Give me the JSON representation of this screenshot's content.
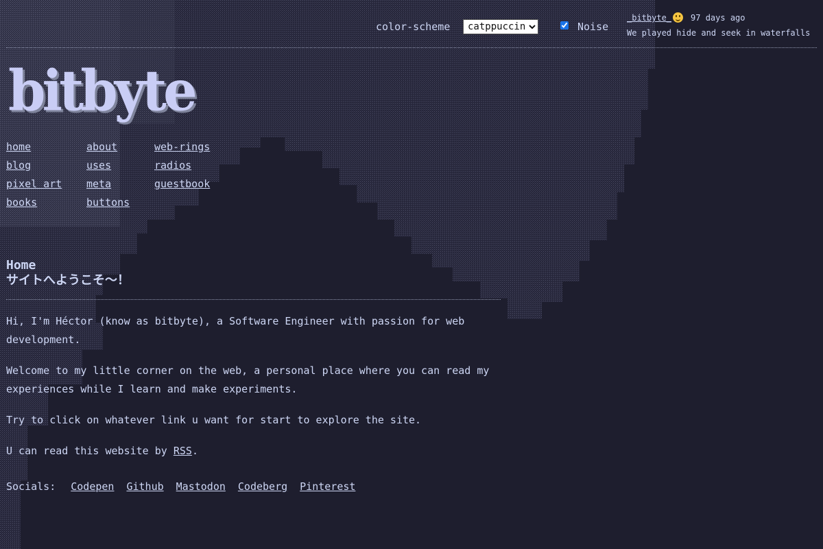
{
  "header": {
    "color_scheme_label": "color-scheme",
    "color_scheme_value": "catppuccin",
    "color_scheme_options": [
      "catppuccin"
    ],
    "noise_label": "Noise",
    "noise_checked": true
  },
  "status": {
    "user": "_bitbyte_",
    "emoji": "smiley-face",
    "age": "97 days ago",
    "message": "We played hide and seek in waterfalls"
  },
  "logo": {
    "text": "bitbyte"
  },
  "nav": {
    "items": [
      {
        "label": "home"
      },
      {
        "label": "about"
      },
      {
        "label": "web-rings"
      },
      {
        "label": "blog"
      },
      {
        "label": "uses"
      },
      {
        "label": "radios"
      },
      {
        "label": "pixel art"
      },
      {
        "label": "meta"
      },
      {
        "label": "guestbook"
      },
      {
        "label": "books"
      },
      {
        "label": "buttons"
      }
    ]
  },
  "page": {
    "title": "Home",
    "subtitle": "サイトへようこそ〜！"
  },
  "main": {
    "p1": "Hi, I'm Héctor (know as bitbyte), a Software Engineer with passion for web development.",
    "p2": "Welcome to my little corner on the web, a personal place where you can read my experiences while I learn and make experiments.",
    "p3": "Try to click on whatever link u want for start to explore the site.",
    "p4_prefix": "U can read this website by ",
    "p4_link": "RSS",
    "p4_suffix": "."
  },
  "socials": {
    "label": "Socials:",
    "links": [
      {
        "label": "Codepen"
      },
      {
        "label": "Github"
      },
      {
        "label": "Mastodon"
      },
      {
        "label": "Codeberg"
      },
      {
        "label": "Pinterest"
      }
    ]
  },
  "colors": {
    "background": "#1e1e2e",
    "text": "#cdd6f4",
    "logo": "#c9cdf5"
  }
}
